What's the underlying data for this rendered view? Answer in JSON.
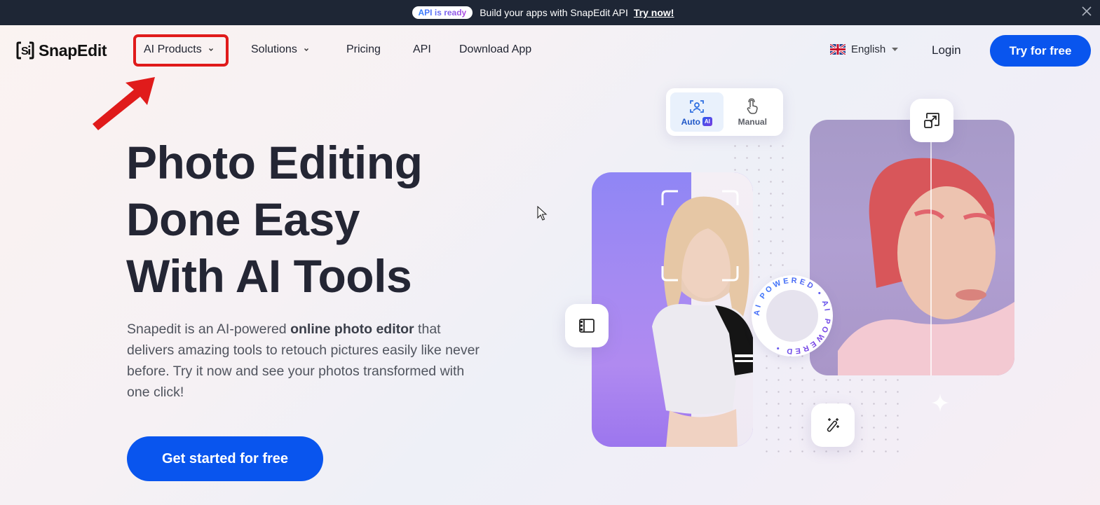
{
  "announcement": {
    "badge": "API is ready",
    "message": "Build your apps with SnapEdit API",
    "link": "Try now!",
    "close_icon": "close-icon",
    "background": "#1e2635"
  },
  "navbar": {
    "logo_text": "SnapEdit",
    "items": [
      {
        "label": "AI Products",
        "has_dropdown": true,
        "highlighted": true
      },
      {
        "label": "Solutions",
        "has_dropdown": true
      },
      {
        "label": "Pricing",
        "has_dropdown": false
      },
      {
        "label": "API",
        "has_dropdown": false
      },
      {
        "label": "Download App",
        "has_dropdown": false
      }
    ],
    "language": {
      "flag": "uk-flag-icon",
      "selected": "English"
    },
    "login": "Login",
    "try_free": "Try for free",
    "accent_color": "#0955ee"
  },
  "annotation": {
    "highlight_color": "#e01b1b",
    "target": "AI Products"
  },
  "hero": {
    "title_lines": [
      "Photo Editing",
      "Done Easy",
      "With AI Tools"
    ],
    "description": {
      "before": "Snapedit is an AI-powered ",
      "bold": "online photo editor",
      "after": " that delivers amazing tools to retouch pictures easily like never before. Try it now and see your photos transformed with one click!"
    },
    "cta": "Get started for free"
  },
  "visual": {
    "mode_toggle": [
      {
        "label": "Auto",
        "chip": "AI",
        "icon": "face-scan-icon",
        "active": true
      },
      {
        "label": "Manual",
        "icon": "hand-pointer-icon",
        "active": false
      }
    ],
    "badge_text": "AI POWERED • AI POWERED •",
    "floating_icons": [
      "compare-resize-icon",
      "film-strip-icon",
      "magic-wand-icon"
    ]
  }
}
